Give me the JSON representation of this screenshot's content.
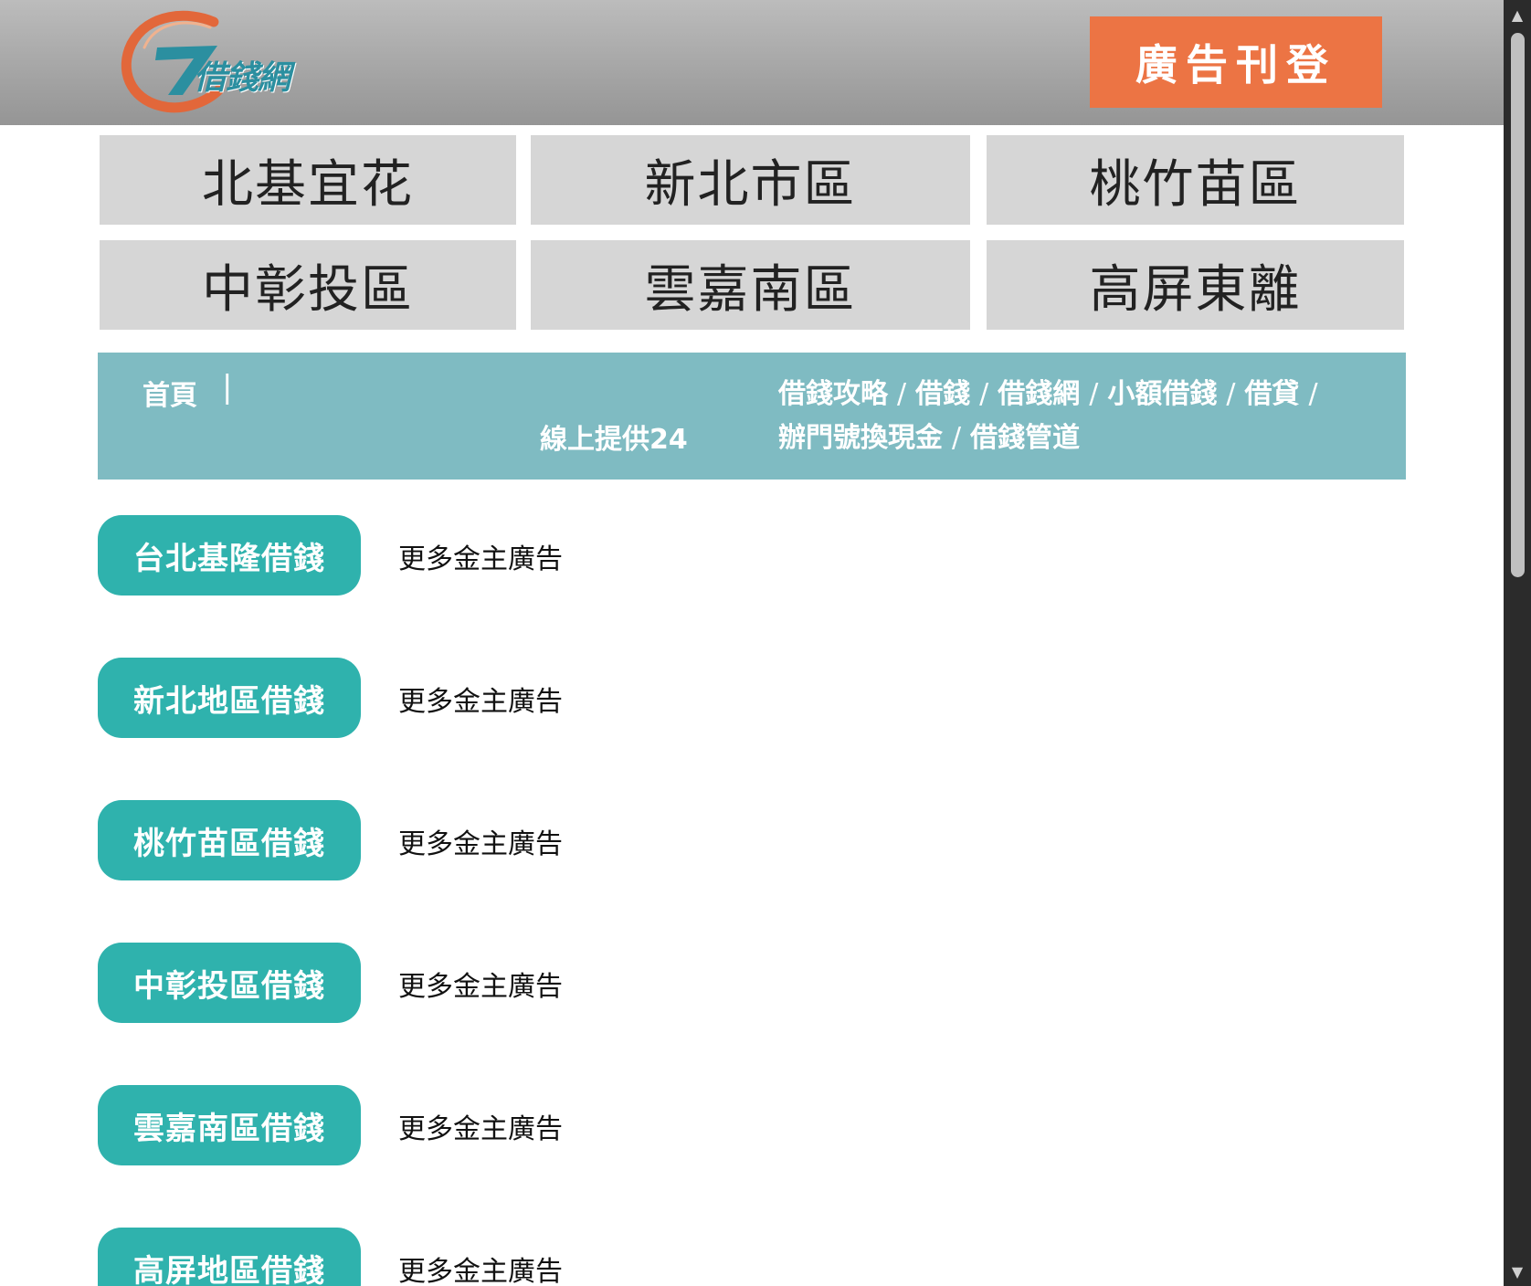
{
  "header": {
    "logo_text": "借錢網",
    "ad_button": "廣告刊登"
  },
  "regions": [
    "北基宜花",
    "新北市區",
    "桃竹苗區",
    "中彰投區",
    "雲嘉南區",
    "高屏東離"
  ],
  "infobar": {
    "home": "首頁",
    "separator": "|",
    "online": "線上提供24",
    "links": [
      "借錢攻略",
      "借錢",
      "借錢網",
      "小額借錢",
      "借貸",
      "辦門號換現金",
      "借錢管道"
    ],
    "link_separator": "/"
  },
  "listings": [
    {
      "button": "台北基隆借錢",
      "more": "更多金主廣告"
    },
    {
      "button": "新北地區借錢",
      "more": "更多金主廣告"
    },
    {
      "button": "桃竹苗區借錢",
      "more": "更多金主廣告"
    },
    {
      "button": "中彰投區借錢",
      "more": "更多金主廣告"
    },
    {
      "button": "雲嘉南區借錢",
      "more": "更多金主廣告"
    },
    {
      "button": "高屏地區借錢",
      "more": "更多金主廣告"
    }
  ],
  "scrollbar": {
    "up_icon": "▲",
    "down_icon": "▼"
  },
  "colors": {
    "ad_button": "#ec7444",
    "tile": "#d6d6d6",
    "infobar": "#7fbbc2",
    "listing_button": "#2fb2ad",
    "logo_orange": "#e2673a",
    "logo_teal": "#2b8fa0"
  }
}
